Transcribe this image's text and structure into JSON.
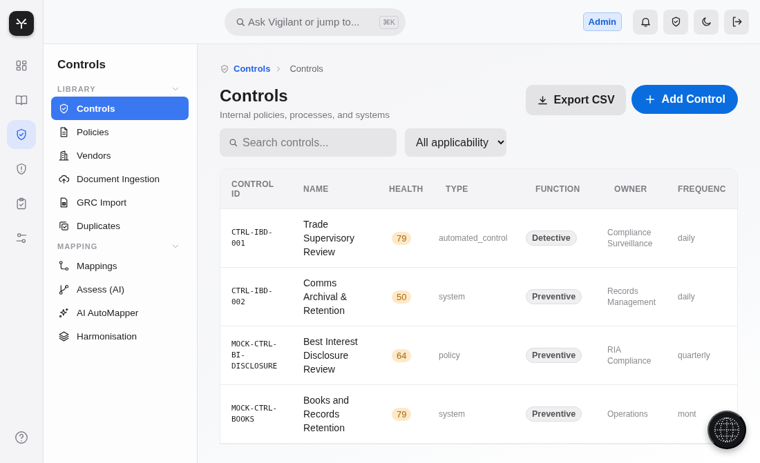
{
  "rail": {
    "items": [
      {
        "selected": false
      },
      {
        "selected": false
      },
      {
        "selected": true
      },
      {
        "selected": false
      },
      {
        "selected": false
      },
      {
        "selected": false
      }
    ]
  },
  "topbar": {
    "search": {
      "placeholder": "Ask Vigilant or jump to...",
      "shortcut": "⌘K"
    },
    "role_badge": "Admin"
  },
  "sidebar": {
    "title": "Controls",
    "sections": [
      {
        "label": "LIBRARY",
        "expanded": true,
        "items": [
          {
            "label": "Controls",
            "selected": true
          },
          {
            "label": "Policies",
            "selected": false
          },
          {
            "label": "Vendors",
            "selected": false
          },
          {
            "label": "Document Ingestion",
            "selected": false
          },
          {
            "label": "GRC Import",
            "selected": false
          },
          {
            "label": "Duplicates",
            "selected": false
          }
        ]
      },
      {
        "label": "MAPPING",
        "expanded": true,
        "items": [
          {
            "label": "Mappings",
            "selected": false
          },
          {
            "label": "Assess (AI)",
            "selected": false
          },
          {
            "label": "AI AutoMapper",
            "selected": false
          },
          {
            "label": "Harmonisation",
            "selected": false
          }
        ]
      }
    ]
  },
  "breadcrumb": [
    "Controls",
    "Controls"
  ],
  "page": {
    "title": "Controls",
    "subtitle": "Internal policies, processes, and systems"
  },
  "actions": {
    "export": "Export CSV",
    "add": "Add Control"
  },
  "filters": {
    "search_placeholder": "Search controls...",
    "applicability": "All applicability"
  },
  "table": {
    "columns": [
      "CONTROL ID",
      "NAME",
      "HEALTH",
      "TYPE",
      "FUNCTION",
      "OWNER",
      "FREQUENC"
    ],
    "rows": [
      {
        "id": "CTRL-IBD-001",
        "name": "Trade Supervisory Review",
        "health": "79",
        "type": "automated_control",
        "function": "Detective",
        "owner": "Compliance Surveillance",
        "frequency": "daily"
      },
      {
        "id": "CTRL-IBD-002",
        "name": "Comms Archival & Retention",
        "health": "50",
        "type": "system",
        "function": "Preventive",
        "owner": "Records Management",
        "frequency": "daily"
      },
      {
        "id": "MOCK-CTRL-BI-DISCLOSURE",
        "name": "Best Interest Disclosure Review",
        "health": "64",
        "type": "policy",
        "function": "Preventive",
        "owner": "RIA Compliance",
        "frequency": "quarterly"
      },
      {
        "id": "MOCK-CTRL-BOOKS",
        "name": "Books and Records Retention",
        "health": "79",
        "type": "system",
        "function": "Preventive",
        "owner": "Operations",
        "frequency": "mont"
      }
    ]
  }
}
